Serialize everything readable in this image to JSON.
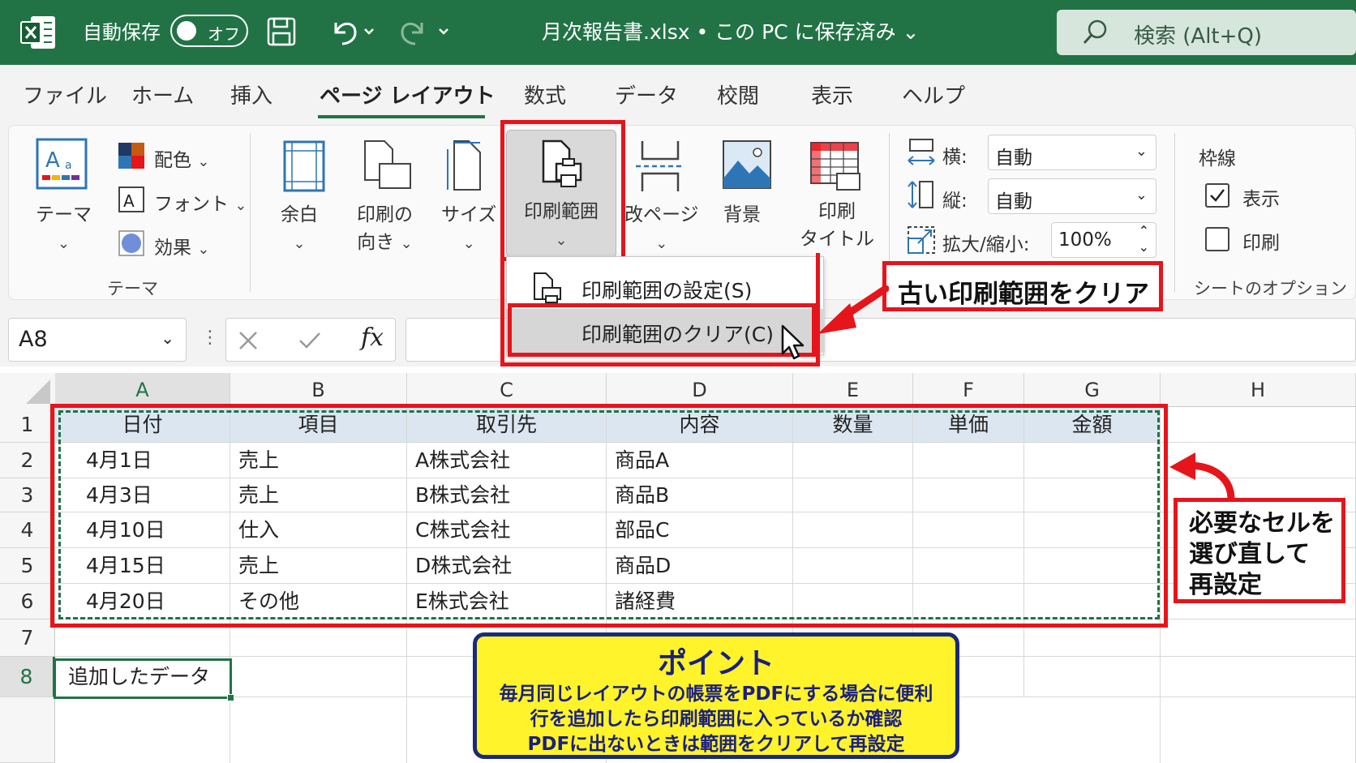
{
  "titlebar": {
    "autosave_label": "自動保存",
    "autosave_state": "オフ",
    "file_title": "月次報告書.xlsx • この PC に保存済み ⌄",
    "search_placeholder": "検索 (Alt+Q)"
  },
  "tabs": [
    "ファイル",
    "ホーム",
    "挿入",
    "ページ レイアウト",
    "数式",
    "データ",
    "校閲",
    "表示",
    "ヘルプ"
  ],
  "ribbon": {
    "theme_btn": "テーマ",
    "colors": "配色",
    "fonts": "フォント",
    "effects": "効果",
    "theme_group": "テーマ",
    "margins": "余白",
    "orientation_l1": "印刷の",
    "orientation_l2": "向き",
    "size": "サイズ",
    "print_area": "印刷範囲",
    "breaks": "改ページ",
    "background": "背景",
    "print_titles_l1": "印刷",
    "print_titles_l2": "タイトル",
    "width_label": "横:",
    "width_value": "自動",
    "height_label": "縦:",
    "height_value": "自動",
    "scale_label": "拡大/縮小:",
    "scale_value": "100%",
    "gridlines": "枠線",
    "gridlines_view": "表示",
    "gridlines_print": "印刷",
    "sheet_options_group": "シートのオプション"
  },
  "dropdown": {
    "set_print_area": "印刷範囲の設定(S)",
    "clear_print_area": "印刷範囲のクリア(C)"
  },
  "callouts": {
    "clear_old": "古い印刷範囲をクリア",
    "reselect_l1": "必要なセルを",
    "reselect_l2": "選び直して",
    "reselect_l3": "再設定"
  },
  "formula_bar": {
    "name_box": "A8",
    "fx": "fx"
  },
  "columns": [
    "A",
    "B",
    "C",
    "D",
    "E",
    "F",
    "G",
    "H"
  ],
  "rows": [
    "1",
    "2",
    "3",
    "4",
    "5",
    "6",
    "7",
    "8"
  ],
  "table": {
    "headers": [
      "日付",
      "項目",
      "取引先",
      "内容",
      "数量",
      "単価",
      "金額"
    ],
    "data": [
      [
        "4月1日",
        "売上",
        "A株式会社",
        "商品A"
      ],
      [
        "4月3日",
        "売上",
        "B株式会社",
        "商品B"
      ],
      [
        "4月10日",
        "仕入",
        "C株式会社",
        "部品C"
      ],
      [
        "4月15日",
        "売上",
        "D株式会社",
        "商品D"
      ],
      [
        "4月20日",
        "その他",
        "E株式会社",
        "諸経費"
      ]
    ],
    "added_row": "追加したデータ"
  },
  "point": {
    "title": "ポイント",
    "line1": "毎月同じレイアウトの帳票をPDFにする場合に便利",
    "line2": "行を追加したら印刷範囲に入っているか確認",
    "line3": "PDFに出ないときは範囲をクリアして再設定"
  },
  "colors": {
    "excel_green": "#217346",
    "red": "#e6141b",
    "header_fill": "#dce6f1",
    "point_fill": "#fff32c",
    "point_border": "#1a2a7a"
  },
  "icons": [
    "excel-logo-icon",
    "save-icon",
    "undo-icon",
    "redo-icon",
    "search-icon",
    "theme-icon",
    "colors-icon",
    "fonts-icon",
    "effects-icon",
    "margins-icon",
    "orientation-icon",
    "size-icon",
    "print-area-icon",
    "breaks-icon",
    "background-icon",
    "print-titles-icon",
    "width-icon",
    "height-icon",
    "scale-icon",
    "cursor-icon"
  ]
}
